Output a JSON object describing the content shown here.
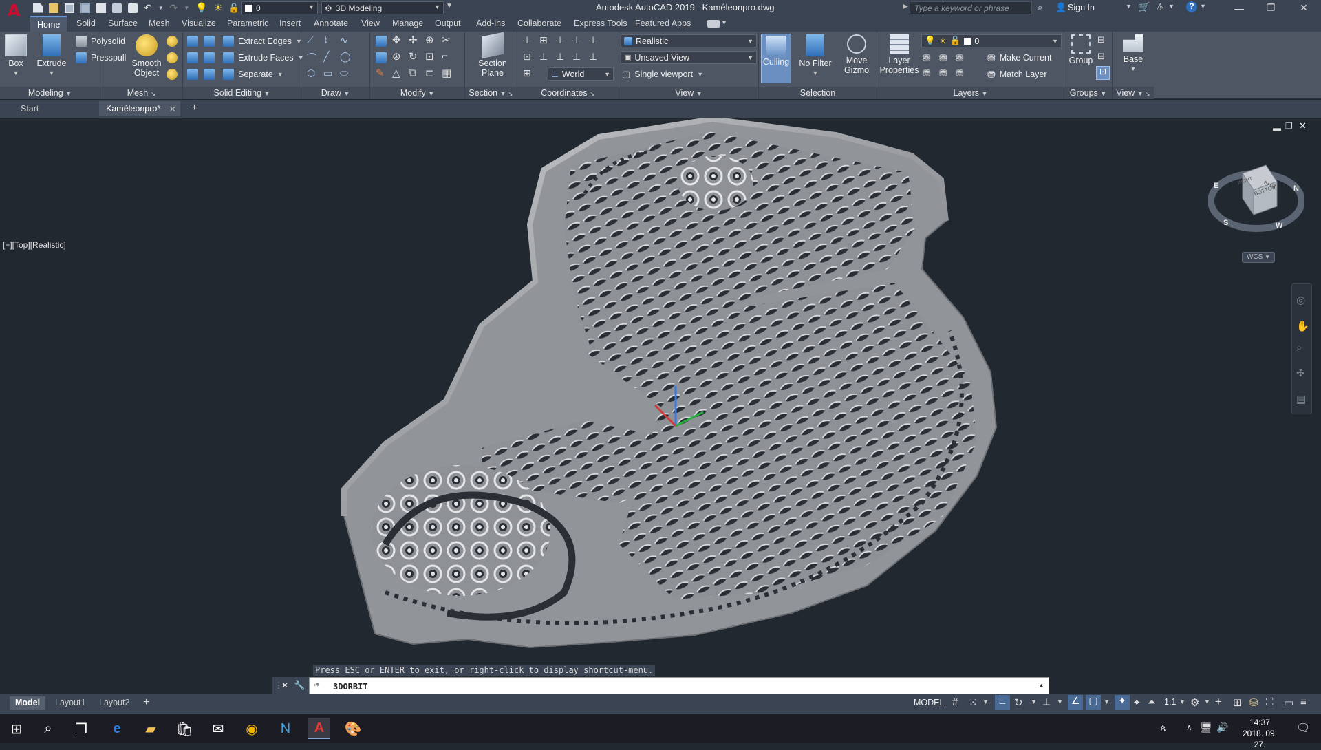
{
  "app": {
    "title": "Autodesk AutoCAD 2019",
    "filename": "Kaméleonpro.dwg",
    "workspace": "3D Modeling",
    "layer_value": "0",
    "search_placeholder": "Type a keyword or phrase",
    "sign_in": "Sign In"
  },
  "ribbon_tabs": [
    "Home",
    "Solid",
    "Surface",
    "Mesh",
    "Visualize",
    "Parametric",
    "Insert",
    "Annotate",
    "View",
    "Manage",
    "Output",
    "Add-ins",
    "Collaborate",
    "Express Tools",
    "Featured Apps"
  ],
  "panels": {
    "modeling": {
      "title": "Modeling",
      "box": "Box",
      "extrude": "Extrude",
      "polysolid": "Polysolid",
      "presspull": "Presspull"
    },
    "mesh": {
      "title": "Mesh",
      "smooth": "Smooth",
      "object": "Object"
    },
    "solid_editing": {
      "title": "Solid Editing",
      "extract_edges": "Extract Edges",
      "extrude_faces": "Extrude Faces",
      "separate": "Separate"
    },
    "draw": {
      "title": "Draw"
    },
    "modify": {
      "title": "Modify"
    },
    "section": {
      "title": "Section",
      "section": "Section",
      "plane": "Plane"
    },
    "coordinates": {
      "title": "Coordinates",
      "world": "World"
    },
    "view": {
      "title": "View",
      "visual_style": "Realistic",
      "named_view": "Unsaved View",
      "viewport": "Single viewport"
    },
    "selection": {
      "title": "Selection",
      "culling": "Culling",
      "no_filter": "No Filter",
      "move": "Move",
      "gizmo": "Gizmo"
    },
    "layers": {
      "title": "Layers",
      "layer_properties_1": "Layer",
      "layer_properties_2": "Properties",
      "layer_value": "0",
      "make_current": "Make Current",
      "match_layer": "Match Layer"
    },
    "groups": {
      "title": "Groups",
      "group": "Group"
    },
    "view2": {
      "title": "View",
      "base": "Base"
    }
  },
  "doc_tabs": [
    "Start",
    "Kaméleonpro*"
  ],
  "viewport_label": "[−][Top][Realistic]",
  "viewcube": {
    "top_face": "BOTTOM",
    "side1": "RIGHT",
    "side2": "BACK",
    "compass": [
      "N",
      "W",
      "S",
      "E"
    ],
    "wcs": "WCS"
  },
  "command": {
    "hint": "Press ESC or ENTER to exit, or right-click to display shortcut-menu.",
    "input": "3DORBIT"
  },
  "layout_tabs": [
    "Model",
    "Layout1",
    "Layout2"
  ],
  "status": {
    "model": "MODEL",
    "scale": "1:1"
  },
  "taskbar": {
    "time": "14:37",
    "date": "2018. 09. 27."
  }
}
